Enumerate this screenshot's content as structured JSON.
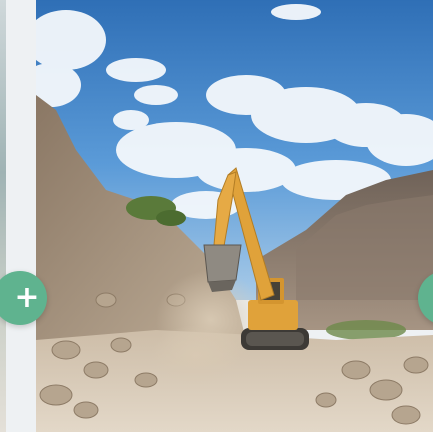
{
  "carousel": {
    "current_photo": {
      "subject": "excavator-in-mountain-quarry"
    },
    "buttons": {
      "prev_add_symbol": "+",
      "next_add_symbol": "+",
      "prev_icon": "plus-icon",
      "next_icon": "plus-icon"
    }
  },
  "colors": {
    "fab_accent": "#5fb38f",
    "sky": "#3d7fc4",
    "excavator": "#e0a23a",
    "background": "#eef1f3"
  }
}
